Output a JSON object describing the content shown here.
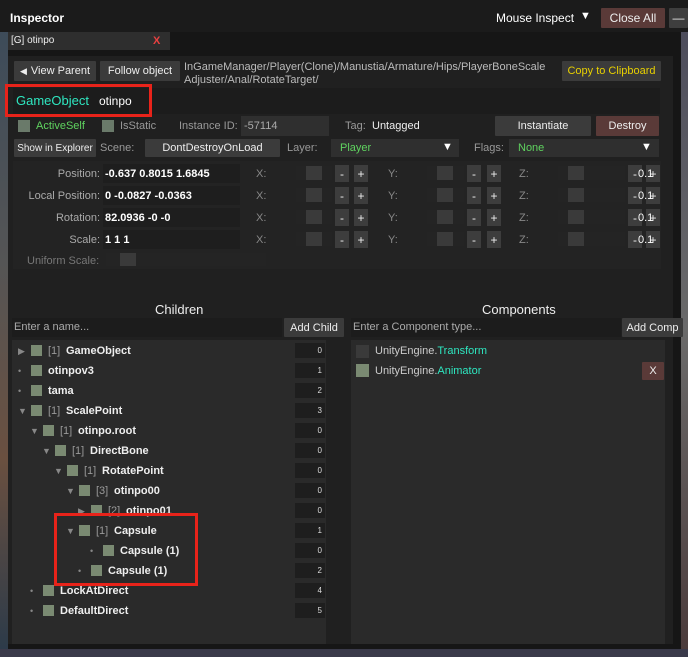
{
  "window": {
    "title": "Inspector",
    "mouse_inspect": "Mouse Inspect",
    "close_all": "Close All",
    "minimize": "—"
  },
  "tab": {
    "label": "[G] otinpo",
    "close": "X"
  },
  "nav": {
    "view_parent": "View Parent",
    "follow_object": "Follow object",
    "path_line1": "InGameManager/Player(Clone)/Manustia/Armature/Hips/PlayerBoneScale",
    "path_line2": "Adjuster/Anal/RotateTarget/",
    "copy": "Copy to Clipboard"
  },
  "object": {
    "type_label": "GameObject",
    "name": "otinpo",
    "active_self": "ActiveSelf",
    "is_static": "IsStatic",
    "instance_id_label": "Instance ID:",
    "instance_id": "-57114",
    "tag_label": "Tag:",
    "tag": "Untagged",
    "instantiate": "Instantiate",
    "destroy": "Destroy",
    "show_in_explorer": "Show in Explorer",
    "scene_label": "Scene:",
    "scene": "DontDestroyOnLoad",
    "layer_label": "Layer:",
    "layer": "Player",
    "flags_label": "Flags:",
    "flags": "None"
  },
  "transform": {
    "rows": [
      {
        "label": "Position:",
        "value": "-0.637 0.8015 1.6845"
      },
      {
        "label": "Local Position:",
        "value": "0 -0.0827 -0.0363"
      },
      {
        "label": "Rotation:",
        "value": "82.0936 -0 -0"
      },
      {
        "label": "Scale:",
        "value": "1 1 1"
      }
    ],
    "axis_x": "X:",
    "axis_y": "Y:",
    "axis_z": "Z:",
    "minus": "-",
    "plus": "+",
    "step": "0.1",
    "uniform_scale": "Uniform Scale:"
  },
  "children": {
    "header": "Children",
    "placeholder": "Enter a name...",
    "add_button": "Add Child",
    "items": [
      {
        "arrow": "▶",
        "idx": "[1]",
        "name": "GameObject",
        "count": "0"
      },
      {
        "arrow": "•",
        "idx": "",
        "name": "otinpov3",
        "count": "1"
      },
      {
        "arrow": "•",
        "idx": "",
        "name": "tama",
        "count": "2"
      },
      {
        "arrow": "▼",
        "idx": "[1]",
        "name": "ScalePoint",
        "count": "3"
      },
      {
        "arrow": "▼",
        "idx": "[1]",
        "name": "otinpo.root",
        "count": "0"
      },
      {
        "arrow": "▼",
        "idx": "[1]",
        "name": "DirectBone",
        "count": "0"
      },
      {
        "arrow": "▼",
        "idx": "[1]",
        "name": "RotatePoint",
        "count": "0"
      },
      {
        "arrow": "▼",
        "idx": "[3]",
        "name": "otinpo00",
        "count": "0"
      },
      {
        "arrow": "▶",
        "idx": "[2]",
        "name": "otinpo01",
        "count": "0"
      },
      {
        "arrow": "▼",
        "idx": "[1]",
        "name": "Capsule",
        "count": "1"
      },
      {
        "arrow": "•",
        "idx": "",
        "name": "Capsule (1)",
        "count": "0"
      },
      {
        "arrow": "•",
        "idx": "",
        "name": "Capsule (1)",
        "count": "2"
      },
      {
        "arrow": "•",
        "idx": "",
        "name": "LockAtDirect",
        "count": "4"
      },
      {
        "arrow": "•",
        "idx": "",
        "name": "DefaultDirect",
        "count": "5"
      }
    ]
  },
  "components": {
    "header": "Components",
    "placeholder": "Enter a Component type...",
    "add_button": "Add Comp",
    "items": [
      {
        "prefix": "UnityEngine.",
        "name": "Transform"
      },
      {
        "prefix": "UnityEngine.",
        "name": "Animator",
        "remove": "X"
      }
    ]
  },
  "colors": {
    "accent": "#2ee6c0",
    "warning": "#e8d000",
    "highlight": "#e8231a",
    "active": "#5fd35f"
  }
}
